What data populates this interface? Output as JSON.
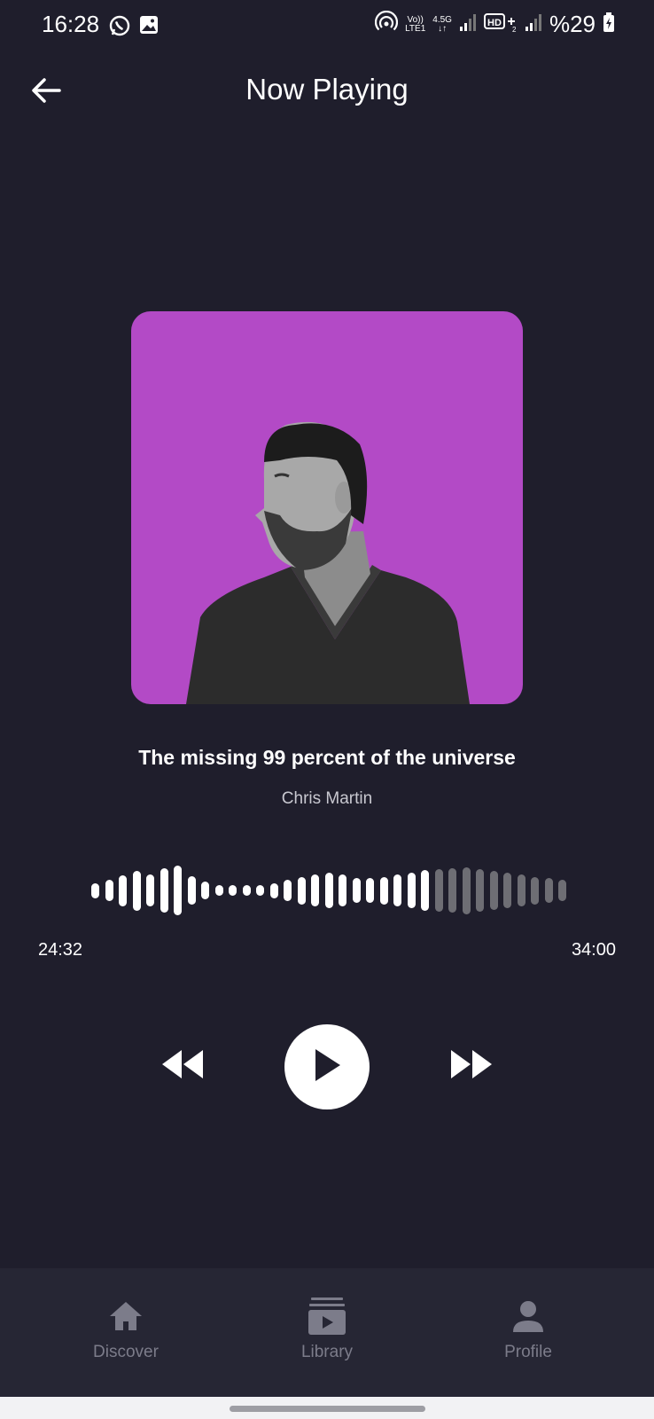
{
  "status_bar": {
    "time": "16:28",
    "network_top": "Vo))",
    "network_bottom": "LTE1",
    "gen_top": "4.5G",
    "gen_bottom": "↓↑",
    "battery": "%29",
    "icons": [
      "whatsapp-icon",
      "gallery-icon",
      "hotspot-icon",
      "signal-icon",
      "hd-icon",
      "signal-icon",
      "battery-charging-icon"
    ]
  },
  "header": {
    "title": "Now Playing",
    "back_icon": "arrow-left-icon"
  },
  "album": {
    "background_color": "#b34ac6",
    "image": "portrait of a bearded man in a t-shirt"
  },
  "track": {
    "title": "The missing 99 percent of the universe",
    "artist": "Chris Martin"
  },
  "progress": {
    "elapsed": "24:32",
    "total": "34:00",
    "played_fraction": 0.72
  },
  "waveform": {
    "bar_heights": [
      0.3,
      0.42,
      0.62,
      0.8,
      0.64,
      0.9,
      1.0,
      0.58,
      0.35,
      0.22,
      0.22,
      0.22,
      0.22,
      0.3,
      0.42,
      0.55,
      0.64,
      0.72,
      0.64,
      0.5,
      0.5,
      0.56,
      0.64,
      0.72,
      0.82,
      0.86,
      0.9,
      0.95,
      0.86,
      0.78,
      0.72,
      0.64,
      0.56,
      0.5,
      0.42
    ],
    "played_color": "#ffffff",
    "unplayed_color": "#6e6e74"
  },
  "controls": {
    "rewind_icon": "rewind-icon",
    "play_icon": "play-icon",
    "forward_icon": "fast-forward-icon"
  },
  "nav": {
    "items": [
      {
        "label": "Discover",
        "icon": "home-icon"
      },
      {
        "label": "Library",
        "icon": "library-icon"
      },
      {
        "label": "Profile",
        "icon": "person-icon"
      }
    ]
  }
}
